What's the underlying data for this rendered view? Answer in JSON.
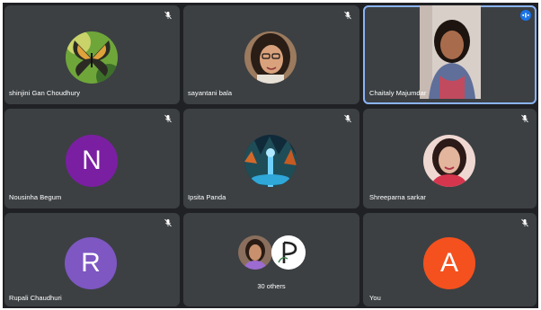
{
  "participants": [
    {
      "name": "shinjini Gan Choudhury",
      "avatar": "butterfly-photo"
    },
    {
      "name": "sayantani bala",
      "avatar": "woman-glasses-photo"
    },
    {
      "name": "Chaitaly Majumdar",
      "avatar": "live-video"
    },
    {
      "name": "Nousinha Begum",
      "letter": "N",
      "color": "#7b1fa2"
    },
    {
      "name": "Ipsita Panda",
      "avatar": "forest-photo"
    },
    {
      "name": "Shreeparna sarkar",
      "avatar": "woman-photo"
    },
    {
      "name": "Rupali Chaudhuri",
      "letter": "R",
      "color": "#7e57c2"
    },
    {
      "name": "",
      "others": "30 others"
    },
    {
      "name": "You",
      "letter": "A",
      "color": "#f4511e"
    }
  ],
  "icons": {
    "muted": "mic-off-icon",
    "speaking": "audio-bars-icon"
  }
}
